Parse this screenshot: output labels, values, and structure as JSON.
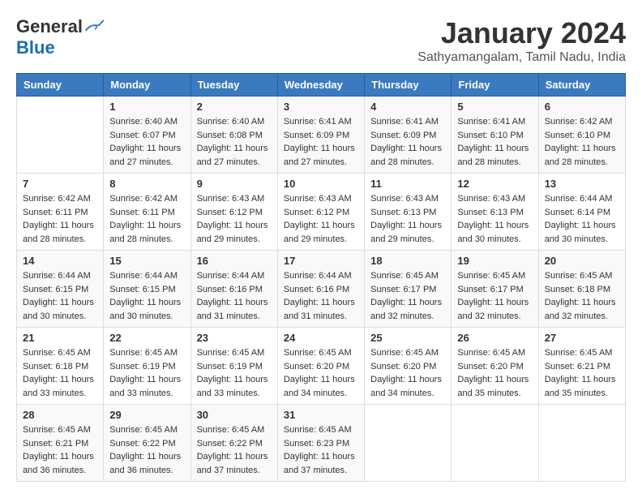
{
  "logo": {
    "general": "General",
    "blue": "Blue"
  },
  "title": "January 2024",
  "location": "Sathyamangalam, Tamil Nadu, India",
  "days_header": [
    "Sunday",
    "Monday",
    "Tuesday",
    "Wednesday",
    "Thursday",
    "Friday",
    "Saturday"
  ],
  "weeks": [
    [
      {
        "day": "",
        "info": ""
      },
      {
        "day": "1",
        "info": "Sunrise: 6:40 AM\nSunset: 6:07 PM\nDaylight: 11 hours\nand 27 minutes."
      },
      {
        "day": "2",
        "info": "Sunrise: 6:40 AM\nSunset: 6:08 PM\nDaylight: 11 hours\nand 27 minutes."
      },
      {
        "day": "3",
        "info": "Sunrise: 6:41 AM\nSunset: 6:09 PM\nDaylight: 11 hours\nand 27 minutes."
      },
      {
        "day": "4",
        "info": "Sunrise: 6:41 AM\nSunset: 6:09 PM\nDaylight: 11 hours\nand 28 minutes."
      },
      {
        "day": "5",
        "info": "Sunrise: 6:41 AM\nSunset: 6:10 PM\nDaylight: 11 hours\nand 28 minutes."
      },
      {
        "day": "6",
        "info": "Sunrise: 6:42 AM\nSunset: 6:10 PM\nDaylight: 11 hours\nand 28 minutes."
      }
    ],
    [
      {
        "day": "7",
        "info": "Sunrise: 6:42 AM\nSunset: 6:11 PM\nDaylight: 11 hours\nand 28 minutes."
      },
      {
        "day": "8",
        "info": "Sunrise: 6:42 AM\nSunset: 6:11 PM\nDaylight: 11 hours\nand 28 minutes."
      },
      {
        "day": "9",
        "info": "Sunrise: 6:43 AM\nSunset: 6:12 PM\nDaylight: 11 hours\nand 29 minutes."
      },
      {
        "day": "10",
        "info": "Sunrise: 6:43 AM\nSunset: 6:12 PM\nDaylight: 11 hours\nand 29 minutes."
      },
      {
        "day": "11",
        "info": "Sunrise: 6:43 AM\nSunset: 6:13 PM\nDaylight: 11 hours\nand 29 minutes."
      },
      {
        "day": "12",
        "info": "Sunrise: 6:43 AM\nSunset: 6:13 PM\nDaylight: 11 hours\nand 30 minutes."
      },
      {
        "day": "13",
        "info": "Sunrise: 6:44 AM\nSunset: 6:14 PM\nDaylight: 11 hours\nand 30 minutes."
      }
    ],
    [
      {
        "day": "14",
        "info": "Sunrise: 6:44 AM\nSunset: 6:15 PM\nDaylight: 11 hours\nand 30 minutes."
      },
      {
        "day": "15",
        "info": "Sunrise: 6:44 AM\nSunset: 6:15 PM\nDaylight: 11 hours\nand 30 minutes."
      },
      {
        "day": "16",
        "info": "Sunrise: 6:44 AM\nSunset: 6:16 PM\nDaylight: 11 hours\nand 31 minutes."
      },
      {
        "day": "17",
        "info": "Sunrise: 6:44 AM\nSunset: 6:16 PM\nDaylight: 11 hours\nand 31 minutes."
      },
      {
        "day": "18",
        "info": "Sunrise: 6:45 AM\nSunset: 6:17 PM\nDaylight: 11 hours\nand 32 minutes."
      },
      {
        "day": "19",
        "info": "Sunrise: 6:45 AM\nSunset: 6:17 PM\nDaylight: 11 hours\nand 32 minutes."
      },
      {
        "day": "20",
        "info": "Sunrise: 6:45 AM\nSunset: 6:18 PM\nDaylight: 11 hours\nand 32 minutes."
      }
    ],
    [
      {
        "day": "21",
        "info": "Sunrise: 6:45 AM\nSunset: 6:18 PM\nDaylight: 11 hours\nand 33 minutes."
      },
      {
        "day": "22",
        "info": "Sunrise: 6:45 AM\nSunset: 6:19 PM\nDaylight: 11 hours\nand 33 minutes."
      },
      {
        "day": "23",
        "info": "Sunrise: 6:45 AM\nSunset: 6:19 PM\nDaylight: 11 hours\nand 33 minutes."
      },
      {
        "day": "24",
        "info": "Sunrise: 6:45 AM\nSunset: 6:20 PM\nDaylight: 11 hours\nand 34 minutes."
      },
      {
        "day": "25",
        "info": "Sunrise: 6:45 AM\nSunset: 6:20 PM\nDaylight: 11 hours\nand 34 minutes."
      },
      {
        "day": "26",
        "info": "Sunrise: 6:45 AM\nSunset: 6:20 PM\nDaylight: 11 hours\nand 35 minutes."
      },
      {
        "day": "27",
        "info": "Sunrise: 6:45 AM\nSunset: 6:21 PM\nDaylight: 11 hours\nand 35 minutes."
      }
    ],
    [
      {
        "day": "28",
        "info": "Sunrise: 6:45 AM\nSunset: 6:21 PM\nDaylight: 11 hours\nand 36 minutes."
      },
      {
        "day": "29",
        "info": "Sunrise: 6:45 AM\nSunset: 6:22 PM\nDaylight: 11 hours\nand 36 minutes."
      },
      {
        "day": "30",
        "info": "Sunrise: 6:45 AM\nSunset: 6:22 PM\nDaylight: 11 hours\nand 37 minutes."
      },
      {
        "day": "31",
        "info": "Sunrise: 6:45 AM\nSunset: 6:23 PM\nDaylight: 11 hours\nand 37 minutes."
      },
      {
        "day": "",
        "info": ""
      },
      {
        "day": "",
        "info": ""
      },
      {
        "day": "",
        "info": ""
      }
    ]
  ]
}
